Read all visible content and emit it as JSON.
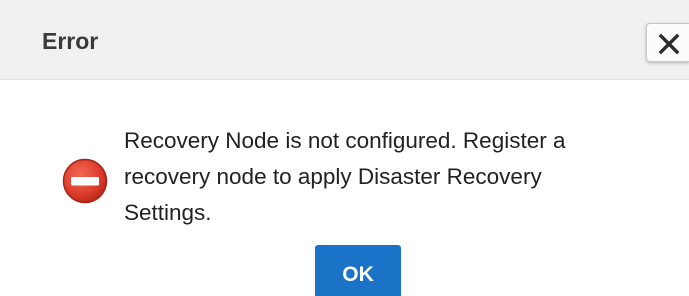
{
  "dialog": {
    "title": "Error",
    "message": "Recovery Node is not configured. Register a\nrecovery node to apply Disaster Recovery\nSettings.",
    "ok_label": "OK",
    "icons": {
      "close": "close-icon",
      "error": "error-icon"
    },
    "colors": {
      "titlebar_bg": "#f1f1f1",
      "ok_button_bg": "#1a73c6",
      "error_icon": "#e0402e"
    }
  }
}
